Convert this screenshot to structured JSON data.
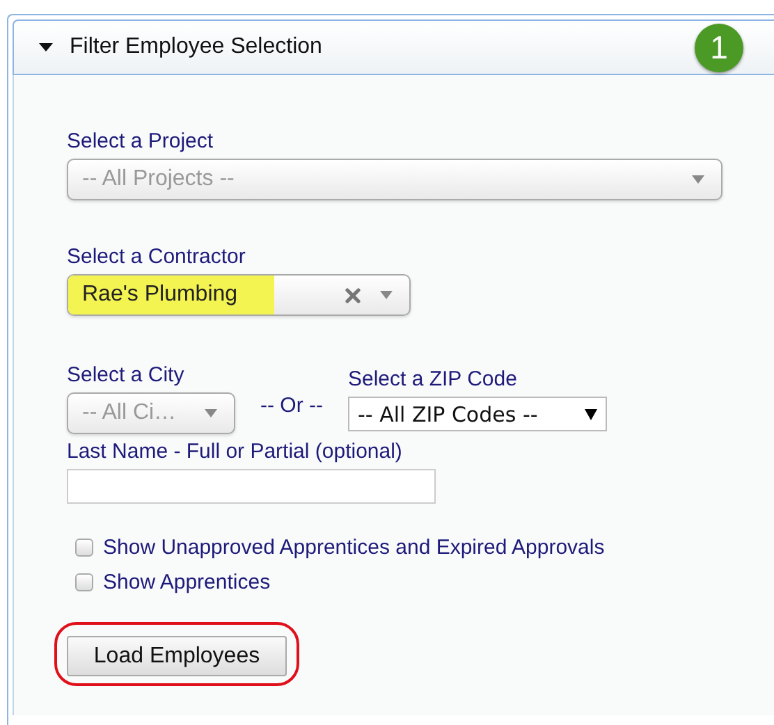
{
  "panel": {
    "title": "Filter Employee Selection",
    "expanded": true,
    "step_badge": "1"
  },
  "project": {
    "label": "Select a Project",
    "value": "-- All Projects --",
    "disabled": true
  },
  "contractor": {
    "label": "Select a Contractor",
    "value": "Rae's Plumbing",
    "highlighted": true,
    "clearable": true
  },
  "city": {
    "label": "Select a City",
    "value": "-- All Ci…",
    "disabled": true
  },
  "or_text": "-- Or --",
  "zip": {
    "label": "Select a ZIP Code",
    "value": "-- All ZIP Codes --"
  },
  "last_name": {
    "label": "Last Name - Full or Partial (optional)"
  },
  "options": [
    {
      "label": "Show Unapproved Apprentices and Expired Approvals",
      "checked": false
    },
    {
      "label": "Show Apprentices",
      "checked": false
    }
  ],
  "load_button": {
    "label": "Load Employees",
    "circled": true
  }
}
